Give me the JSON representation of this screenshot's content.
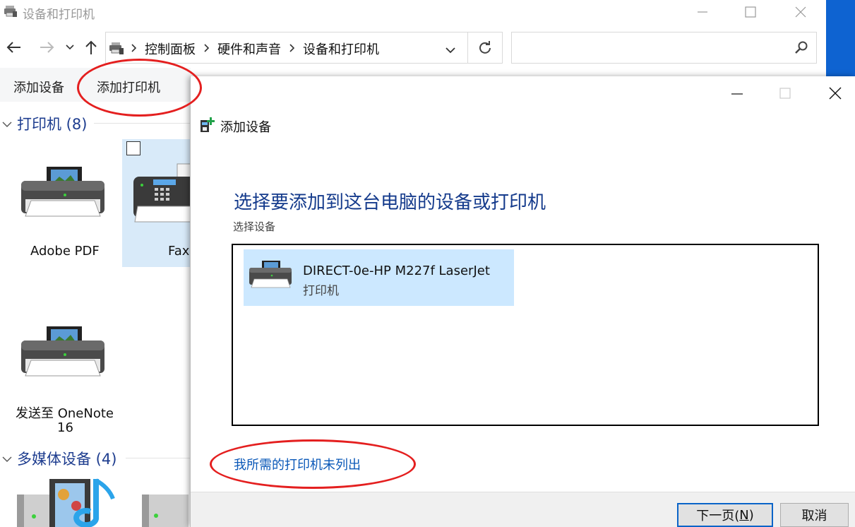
{
  "window": {
    "title": "设备和打印机"
  },
  "address_bar": {
    "crumbs": [
      "控制面板",
      "硬件和声音",
      "设备和打印机"
    ]
  },
  "search": {
    "placeholder": ""
  },
  "command_bar": {
    "add_device": "添加设备",
    "add_printer": "添加打印机"
  },
  "groups": [
    {
      "label": "打印机 (8)"
    },
    {
      "label": "多媒体设备 (4)"
    }
  ],
  "devices": [
    {
      "label": "Adobe PDF"
    },
    {
      "label": "Fax"
    },
    {
      "label_line1": "发送至 OneNote",
      "label_line2": "16"
    }
  ],
  "dialog": {
    "title": "添加设备",
    "heading": "选择要添加到这台电脑的设备或打印机",
    "subheading": "选择设备",
    "devices": [
      {
        "name": "DIRECT-0e-HP M227f LaserJet",
        "type": "打印机"
      }
    ],
    "not_listed_link": "我所需的打印机未列出",
    "next_button": "下一页(N)",
    "next_button_text": "下一页(",
    "next_button_accel": "N",
    "next_button_close": ")",
    "cancel_button": "取消"
  },
  "annotations": {
    "color": "#e41f1f",
    "highlighted": [
      "添加打印机",
      "我所需的打印机未列出"
    ]
  },
  "colors": {
    "accent_blue": "#0e63d1",
    "heading_blue": "#153b8c",
    "link_blue": "#0a58b8",
    "selection": "#cce8ff"
  }
}
